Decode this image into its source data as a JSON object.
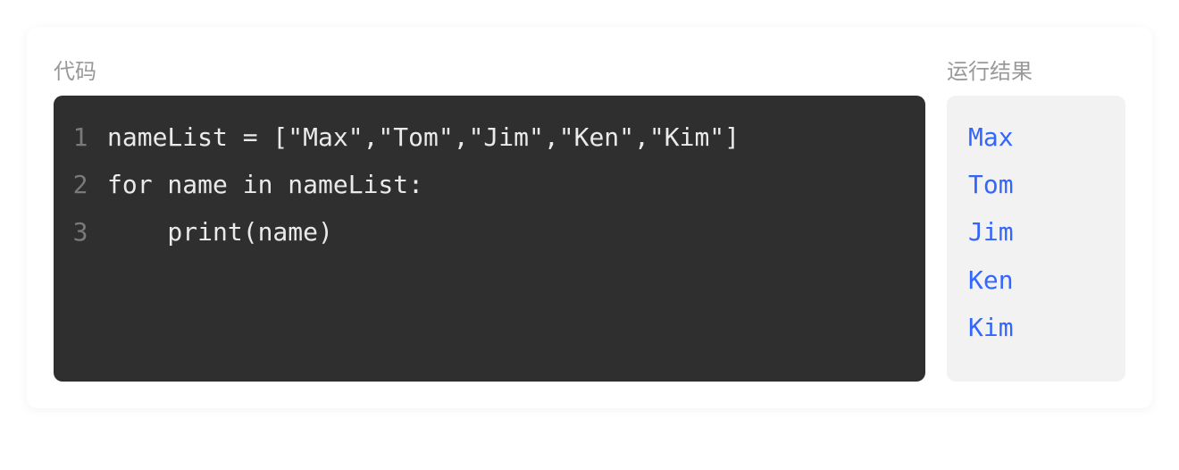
{
  "labels": {
    "code": "代码",
    "result": "运行结果"
  },
  "code": {
    "lines": [
      {
        "num": "1",
        "text": "nameList = [\"Max\",\"Tom\",\"Jim\",\"Ken\",\"Kim\"]"
      },
      {
        "num": "2",
        "text": "for name in nameList:"
      },
      {
        "num": "3",
        "text": "    print(name)"
      }
    ]
  },
  "result": {
    "lines": [
      "Max",
      "Tom",
      "Jim",
      "Ken",
      "Kim"
    ]
  }
}
